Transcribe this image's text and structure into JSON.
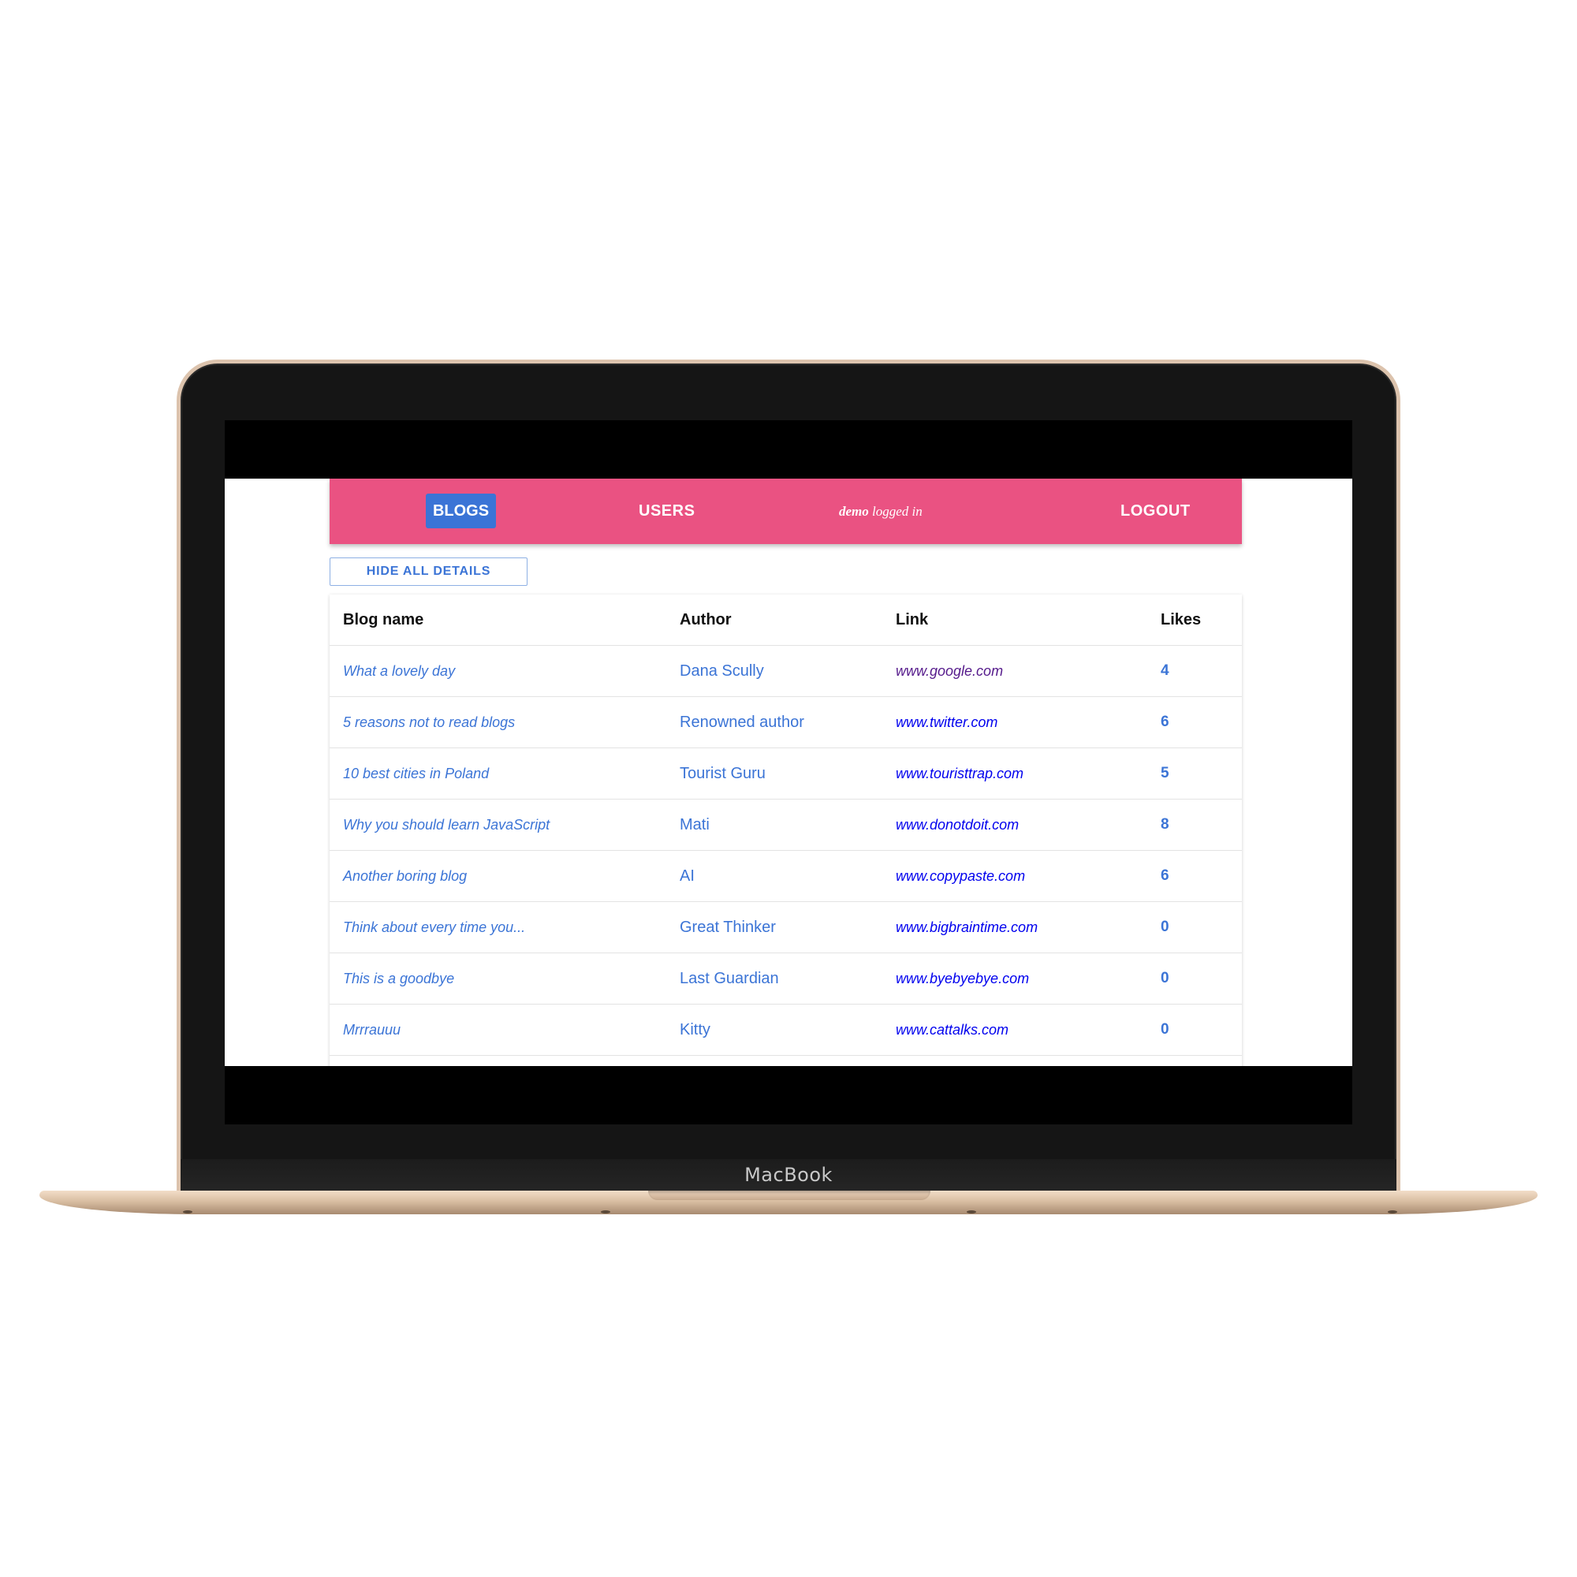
{
  "device": {
    "brand_label": "MacBook"
  },
  "nav": {
    "blogs_label": "BLOGS",
    "users_label": "USERS",
    "logged_user": "demo",
    "logged_in_text": "logged in",
    "logout_label": "LOGOUT",
    "bar_color": "#ea5282",
    "active_color": "#3b74d6"
  },
  "toolbar": {
    "hide_details_label": "HIDE ALL DETAILS"
  },
  "table": {
    "headers": {
      "name": "Blog name",
      "author": "Author",
      "link": "Link",
      "likes": "Likes"
    },
    "rows": [
      {
        "name": "What a lovely day",
        "author": "Dana Scully",
        "link": "www.google.com",
        "likes": "4",
        "visited": true
      },
      {
        "name": "5 reasons not to read blogs",
        "author": "Renowned author",
        "link": "www.twitter.com",
        "likes": "6",
        "visited": false
      },
      {
        "name": "10 best cities in Poland",
        "author": "Tourist Guru",
        "link": "www.touristtrap.com",
        "likes": "5",
        "visited": false
      },
      {
        "name": "Why you should learn JavaScript",
        "author": "Mati",
        "link": "www.donotdoit.com",
        "likes": "8",
        "visited": false
      },
      {
        "name": "Another boring blog",
        "author": "AI",
        "link": "www.copypaste.com",
        "likes": "6",
        "visited": false
      },
      {
        "name": "Think about every time you...",
        "author": "Great Thinker",
        "link": "www.bigbraintime.com",
        "likes": "0",
        "visited": false
      },
      {
        "name": "This is a goodbye",
        "author": "Last Guardian",
        "link": "www.byebyebye.com",
        "likes": "0",
        "visited": false
      },
      {
        "name": "Mrrrauuu",
        "author": "Kitty",
        "link": "www.cattalks.com",
        "likes": "0",
        "visited": false
      }
    ]
  }
}
